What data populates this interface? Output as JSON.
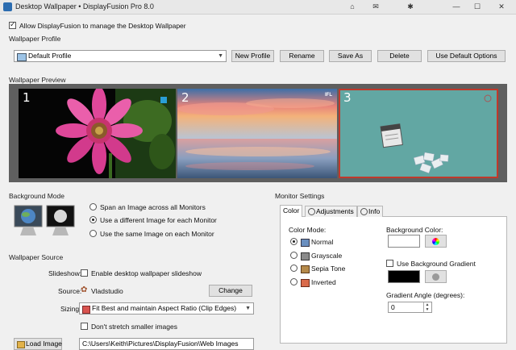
{
  "window": {
    "title": "Desktop Wallpaper • DisplayFusion Pro 8.0",
    "controls": [
      "⌂",
      "✉",
      "✱",
      "—",
      "☐",
      "✕"
    ]
  },
  "allow_manage": {
    "label": "Allow DisplayFusion to manage the Desktop Wallpaper",
    "checked": true
  },
  "wallpaper_profile": {
    "title": "Wallpaper Profile",
    "selected": "Default Profile",
    "buttons": {
      "new_profile": "New Profile",
      "rename": "Rename",
      "save_as": "Save As",
      "delete": "Delete",
      "use_default": "Use Default Options"
    }
  },
  "wallpaper_preview": {
    "title": "Wallpaper Preview",
    "monitors": [
      {
        "number": "1",
        "badge": ""
      },
      {
        "number": "2",
        "badge": "IFL"
      },
      {
        "number": "3",
        "badge": ""
      }
    ]
  },
  "background_mode": {
    "title": "Background Mode",
    "options": [
      {
        "label": "Span an Image across all Monitors",
        "selected": false
      },
      {
        "label": "Use a different Image for each Monitor",
        "selected": true
      },
      {
        "label": "Use the same Image on each Monitor",
        "selected": false
      }
    ]
  },
  "wallpaper_source": {
    "title": "Wallpaper Source",
    "slideshow_label": "Slideshow:",
    "slideshow_option": "Enable desktop wallpaper slideshow",
    "slideshow_checked": false,
    "source_label": "Source:",
    "source_value": "Vladstudio",
    "change_button": "Change",
    "sizing_label": "Sizing:",
    "sizing_value": "Fit Best and maintain Aspect Ratio (Clip Edges)",
    "dont_stretch": "Don't stretch smaller images",
    "dont_stretch_checked": false,
    "load_image_button": "Load Image",
    "path_value": "C:\\Users\\Keith\\Pictures\\DisplayFusion\\Web Images"
  },
  "monitor_settings": {
    "title": "Monitor Settings",
    "tabs": [
      "Color",
      "Adjustments",
      "Info"
    ],
    "active_tab": "Color",
    "color_mode_label": "Color Mode:",
    "color_modes": [
      {
        "label": "Normal",
        "selected": true
      },
      {
        "label": "Grayscale",
        "selected": false
      },
      {
        "label": "Sepia Tone",
        "selected": false
      },
      {
        "label": "Inverted",
        "selected": false
      }
    ],
    "background_color_label": "Background Color:",
    "background_color": "#ffffff",
    "use_gradient_label": "Use Background Gradient",
    "use_gradient_checked": false,
    "gradient_color": "#000000",
    "gradient_angle_label": "Gradient Angle (degrees):",
    "gradient_angle_value": "0"
  }
}
